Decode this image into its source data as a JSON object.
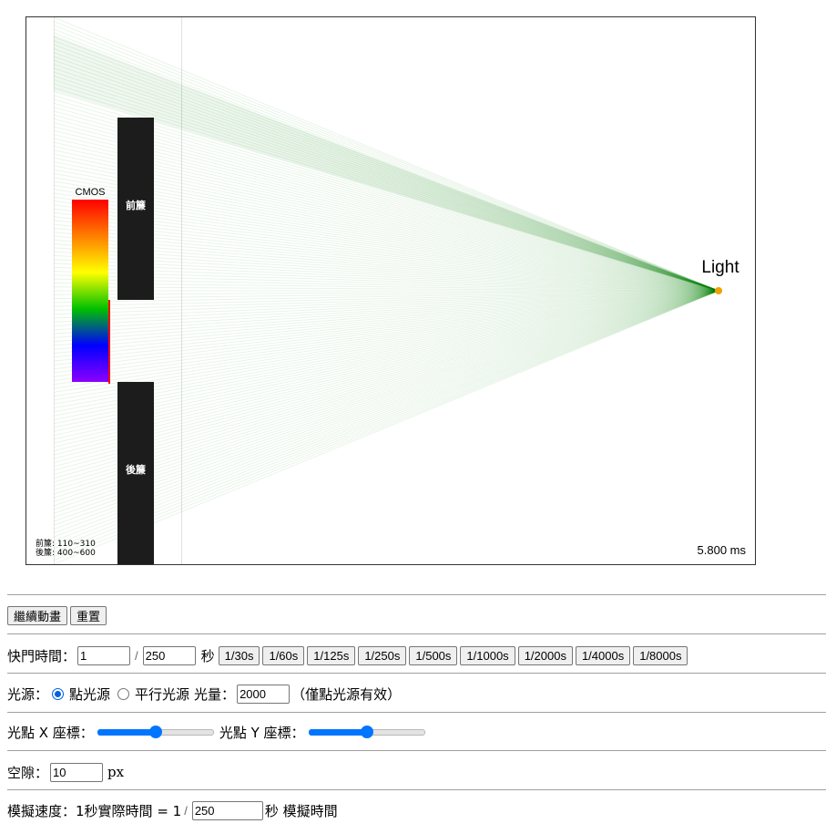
{
  "canvas": {
    "cmos_label": "CMOS",
    "front_curtain_label": "前簾",
    "rear_curtain_label": "後簾",
    "light_label": "Light",
    "curtain_info_front": "前簾: 110~310",
    "curtain_info_rear": "後簾: 400~600",
    "time_readout": "5.800 ms",
    "colors": {
      "curtain": "#1c1c1c",
      "ray": "#008000",
      "light_dot": "#f0a000",
      "sensor_edge": "#ff0000"
    }
  },
  "controls": {
    "continue_label": "繼續動畫",
    "reset_label": "重置"
  },
  "shutter": {
    "label": "快門時間：",
    "numerator": "1",
    "separator": "/",
    "denominator": "250",
    "unit": "秒",
    "presets": [
      "1/30s",
      "1/60s",
      "1/125s",
      "1/250s",
      "1/500s",
      "1/1000s",
      "1/2000s",
      "1/4000s",
      "1/8000s"
    ]
  },
  "light_source": {
    "label": "光源：",
    "point_label": "點光源",
    "parallel_label": "平行光源",
    "selected": "point",
    "amount_label": "光量：",
    "amount_value": "2000",
    "note": "（僅點光源有效）"
  },
  "position": {
    "x_label": "光點 X 座標：",
    "x_level": 0.5,
    "y_label": "光點 Y 座標：",
    "y_level": 0.5
  },
  "gap": {
    "label": "空隙：",
    "value": "10",
    "unit": "px"
  },
  "speed": {
    "label": "模擬速度：1秒實際時間 = 1",
    "separator": "/",
    "value": "250",
    "suffix": "秒 模擬時間"
  }
}
